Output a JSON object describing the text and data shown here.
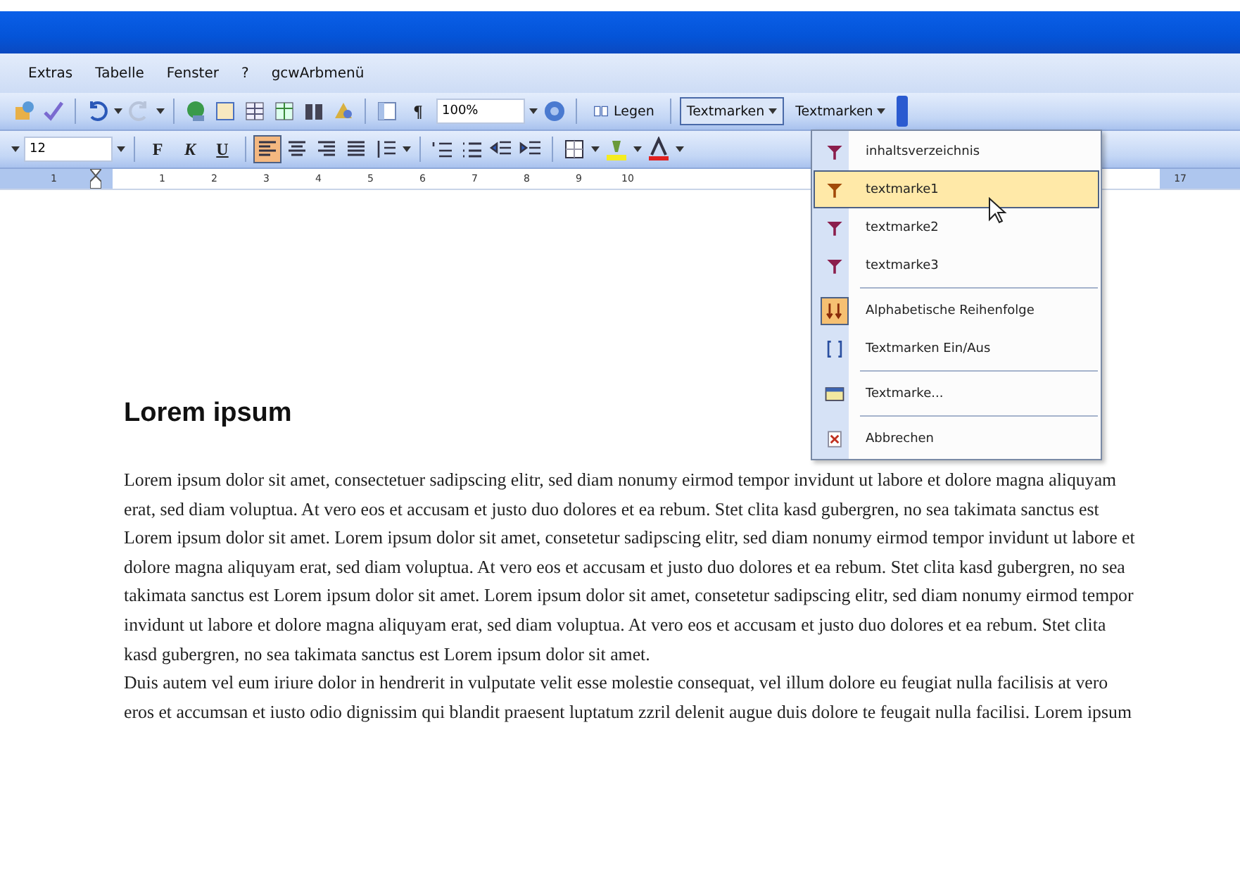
{
  "menu_bar": {
    "items": [
      {
        "label": "Extras"
      },
      {
        "label": "Tabelle"
      },
      {
        "label": "Fenster"
      },
      {
        "label": "?"
      },
      {
        "label": "gcwArbmenü"
      }
    ]
  },
  "standard_toolbar": {
    "pilcrow": "¶",
    "zoom": "100%",
    "read_button": "Legen",
    "bookmark_buttons": [
      {
        "label": "Textmarken",
        "open": true
      },
      {
        "label": "Textmarken",
        "open": false
      }
    ]
  },
  "format_toolbar": {
    "font_size": "12",
    "bold": "F",
    "italic": "K",
    "underline": "U",
    "align_left_on": true
  },
  "ruler": {
    "left_labels": [
      "1"
    ],
    "labels": [
      "1",
      "2",
      "3",
      "4",
      "5",
      "6",
      "7",
      "8",
      "9",
      "10"
    ],
    "right_labels": [
      "17"
    ]
  },
  "bookmark_menu": {
    "items": [
      {
        "kind": "bookmark",
        "label": "inhaltsverzeichnis",
        "selected": false,
        "checked": false,
        "separator_after": false
      },
      {
        "kind": "bookmark",
        "label": "textmarke1",
        "selected": true,
        "checked": false,
        "separator_after": false
      },
      {
        "kind": "bookmark",
        "label": "textmarke2",
        "selected": false,
        "checked": false,
        "separator_after": false
      },
      {
        "kind": "bookmark",
        "label": "textmarke3",
        "selected": false,
        "checked": false,
        "separator_after": true
      },
      {
        "kind": "sort",
        "label": "Alphabetische Reihenfolge",
        "selected": false,
        "checked": true,
        "separator_after": false
      },
      {
        "kind": "toggle",
        "label": "Textmarken Ein/Aus",
        "selected": false,
        "checked": false,
        "separator_after": true
      },
      {
        "kind": "dialog",
        "label": "Textmarke...",
        "selected": false,
        "checked": false,
        "separator_after": true
      },
      {
        "kind": "cancel",
        "label": "Abbrechen",
        "selected": false,
        "checked": false,
        "separator_after": false
      }
    ]
  },
  "document": {
    "heading": "Lorem ipsum",
    "paragraphs": [
      "Lorem ipsum dolor sit amet, consectetuer sadipscing elitr, sed diam nonumy eirmod tempor invidunt ut labore et dolore magna aliquyam erat, sed diam voluptua. At vero eos et accusam et justo duo dolores et ea rebum. Stet clita kasd gubergren, no sea takimata sanctus est Lorem ipsum dolor sit amet. Lorem ipsum dolor sit amet, consetetur sadipscing elitr, sed diam nonumy eirmod tempor invidunt ut labore et dolore magna aliquyam erat, sed diam voluptua. At vero eos et accusam et justo duo dolores et ea rebum. Stet clita kasd gubergren, no sea takimata sanctus est Lorem ipsum dolor sit amet. Lorem ipsum dolor sit amet, consetetur sadipscing elitr, sed diam nonumy eirmod tempor invidunt ut labore et dolore magna aliquyam erat, sed diam voluptua. At vero eos et accusam et justo duo dolores et ea rebum. Stet clita kasd gubergren, no sea takimata sanctus est Lorem ipsum dolor sit amet.",
      "Duis autem vel eum iriure dolor in hendrerit in vulputate velit esse molestie consequat, vel illum dolore eu feugiat nulla facilisis at vero eros et accumsan et iusto odio dignissim qui blandit praesent luptatum zzril delenit augue duis dolore te feugait nulla facilisi. Lorem ipsum"
    ]
  }
}
